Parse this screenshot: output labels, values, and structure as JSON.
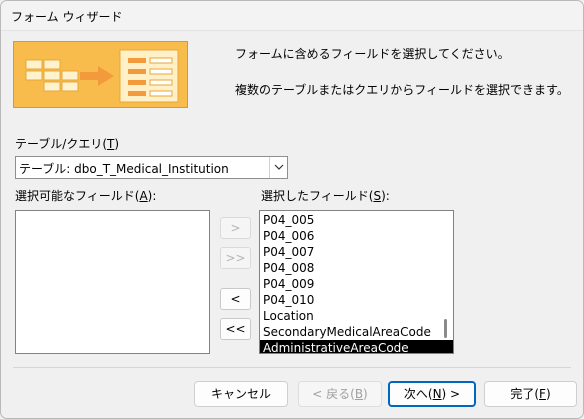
{
  "window": {
    "title": "フォーム ウィザード"
  },
  "intro": {
    "line1": "フォームに含めるフィールドを選択してください。",
    "line2": "複数のテーブルまたはクエリからフィールドを選択できます。"
  },
  "table_query": {
    "label": "テーブル/クエリ(",
    "accesskey": "T",
    "label_end": ")",
    "value": "テーブル: dbo_T_Medical_Institution"
  },
  "available": {
    "label": "選択可能なフィールド(",
    "accesskey": "A",
    "label_end": "):",
    "items": []
  },
  "selected": {
    "label": "選択したフィールド(",
    "accesskey": "S",
    "label_end": "):",
    "items": [
      "P04_005",
      "P04_006",
      "P04_007",
      "P04_008",
      "P04_009",
      "P04_010",
      "Location",
      "SecondaryMedicalAreaCode",
      "AdministrativeAreaCode"
    ],
    "selected_item": "AdministrativeAreaCode"
  },
  "move_buttons": {
    "add_one": ">",
    "add_all": ">>",
    "remove_one": "<",
    "remove_all": "<<"
  },
  "footer": {
    "cancel": "キャンセル",
    "back_pre": "< 戻る(",
    "back_key": "B",
    "back_post": ")",
    "next_pre": "次へ(",
    "next_key": "N",
    "next_post": ") >",
    "finish_pre": "完了(",
    "finish_key": "F",
    "finish_post": ")"
  },
  "colors": {
    "banner": "#f7bc4c",
    "accent": "#0067c0",
    "selection": "#000000"
  }
}
